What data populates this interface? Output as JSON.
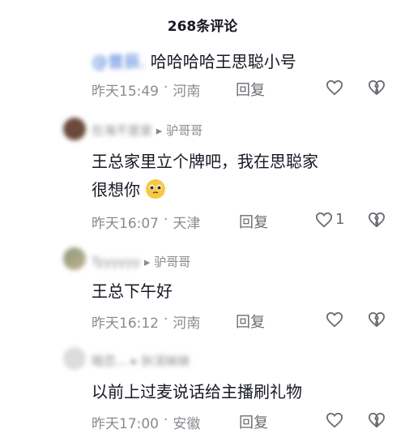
{
  "header": {
    "title": "268条评论"
  },
  "reply_top": {
    "mention": "@曾辰.",
    "text": "哈哈哈哈王思聪小号",
    "time": "昨天15:49",
    "location": "河南",
    "reply_label": "回复"
  },
  "comments": [
    {
      "username": "在海不是家",
      "reply_to": "驴哥哥",
      "text_line1": "王总家里立个牌吧，我在思聪家",
      "text_line2": "很想你",
      "emoji": "pleading-face-emoji",
      "time": "昨天16:07",
      "location": "天津",
      "reply_label": "回复",
      "like_count": "1"
    },
    {
      "username": "Tyyyyyy",
      "reply_to": "驴哥哥",
      "text": "王总下午好",
      "time": "昨天16:12",
      "location": "河南",
      "reply_label": "回复",
      "like_count": ""
    },
    {
      "username": "暗恋...",
      "reply_to": "狄淫妹妹",
      "text": "以前上过麦说话给主播刷礼物",
      "time": "昨天17:00",
      "location": "安徽",
      "reply_label": "回复",
      "like_count": ""
    }
  ],
  "colors": {
    "meta": "#8a8b91",
    "text": "#161823",
    "mention": "#3b6fd6"
  }
}
